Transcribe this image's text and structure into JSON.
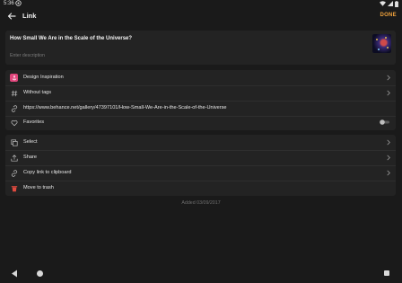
{
  "status_bar": {
    "time": "5:36"
  },
  "app_bar": {
    "title": "Link",
    "done_label": "DONE"
  },
  "link": {
    "title": "How Small We Are in the Scale of the Universe?",
    "description_placeholder": "Enter description"
  },
  "meta": {
    "collection": "Design Inspiration",
    "tags": "Without tags",
    "url": "https://www.behance.net/gallery/47397101/How-Small-We-Are-in-the-Scale-of-the-Universe",
    "favorites_label": "Favorites",
    "favorites_on": false
  },
  "actions": {
    "select": "Select",
    "share": "Share",
    "copy": "Copy link to clipboard",
    "trash": "Move to trash"
  },
  "footer": {
    "added": "Added 03/09/2017"
  },
  "colors": {
    "accent": "#f0a23c",
    "collection_icon": "#e0457b",
    "trash": "#e04a3f",
    "background": "#1a1a1a",
    "card": "#232323"
  }
}
